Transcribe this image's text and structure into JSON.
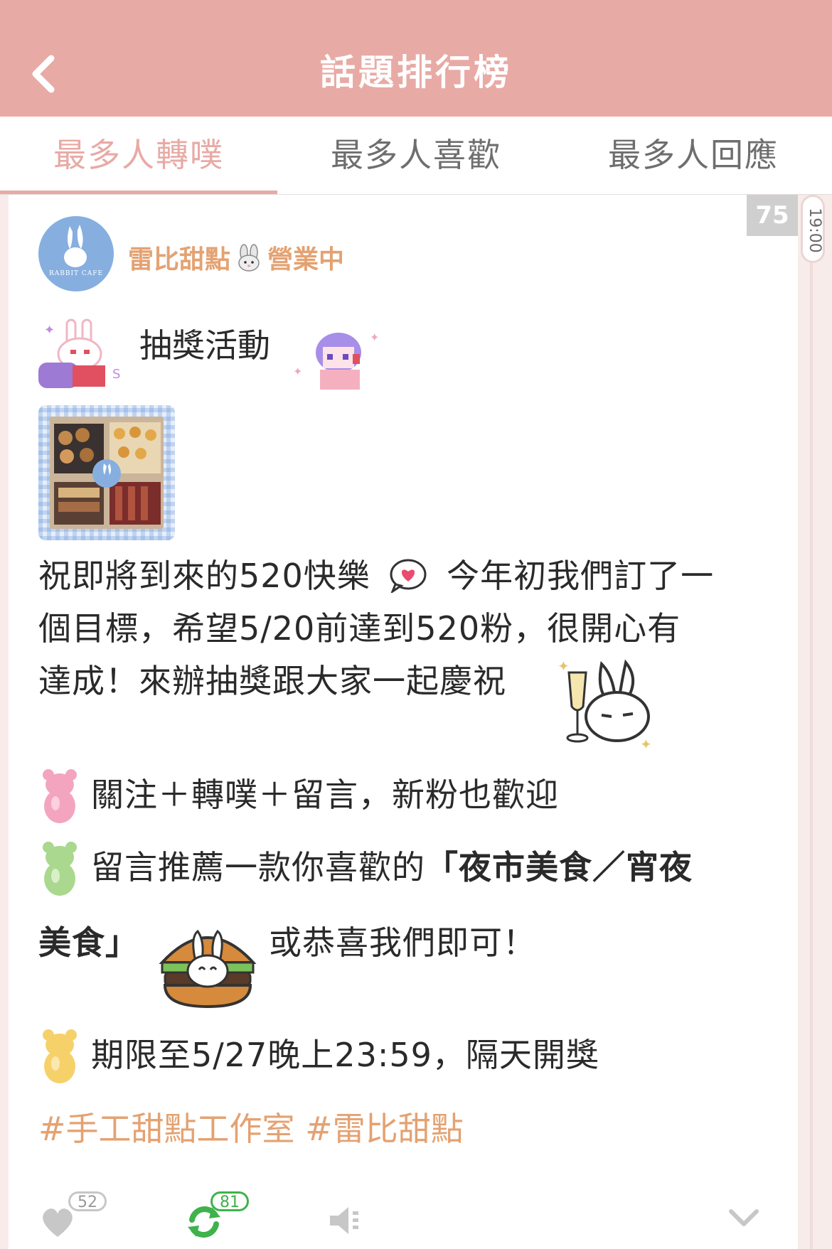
{
  "header": {
    "title": "話題排行榜",
    "back_icon": "chevron-left-icon"
  },
  "tabs": [
    {
      "label": "最多人轉噗",
      "active": true
    },
    {
      "label": "最多人喜歡",
      "active": false
    },
    {
      "label": "最多人回應",
      "active": false
    }
  ],
  "colors": {
    "brand": "#e8aaa5",
    "author": "#e4a272",
    "hashtag": "#e4a272",
    "replurk": "#3fb24c"
  },
  "post": {
    "rank": "75",
    "time": "19:00",
    "avatar_caption": "RABBIT CAFE",
    "author_name": "雷比甜點",
    "author_status": "營業中",
    "title": "抽獎活動",
    "body": {
      "line1": "祝即將到來的520快樂",
      "line1b": "今年初我們訂了一",
      "line2": "個目標，希望5/20前達到520粉，很開心有",
      "line3": "達成！來辦抽獎跟大家一起慶祝",
      "rule1": "關注＋轉噗＋留言，新粉也歡迎",
      "rule2a": "留言推薦一款你喜歡的",
      "rule2b": "「夜市美食／宵夜",
      "rule2c": "美食」",
      "rule2d": "或恭喜我們即可！",
      "rule3": "期限至5/27晚上23:59，隔天開獎"
    },
    "hashtags": [
      "#手工甜點工作室",
      "#雷比甜點"
    ],
    "actions": {
      "like_count": "52",
      "replurk_count": "81",
      "like_icon": "heart-icon",
      "replurk_icon": "replurk-icon",
      "mute_icon": "mute-icon",
      "more_icon": "chevron-down-icon"
    }
  }
}
